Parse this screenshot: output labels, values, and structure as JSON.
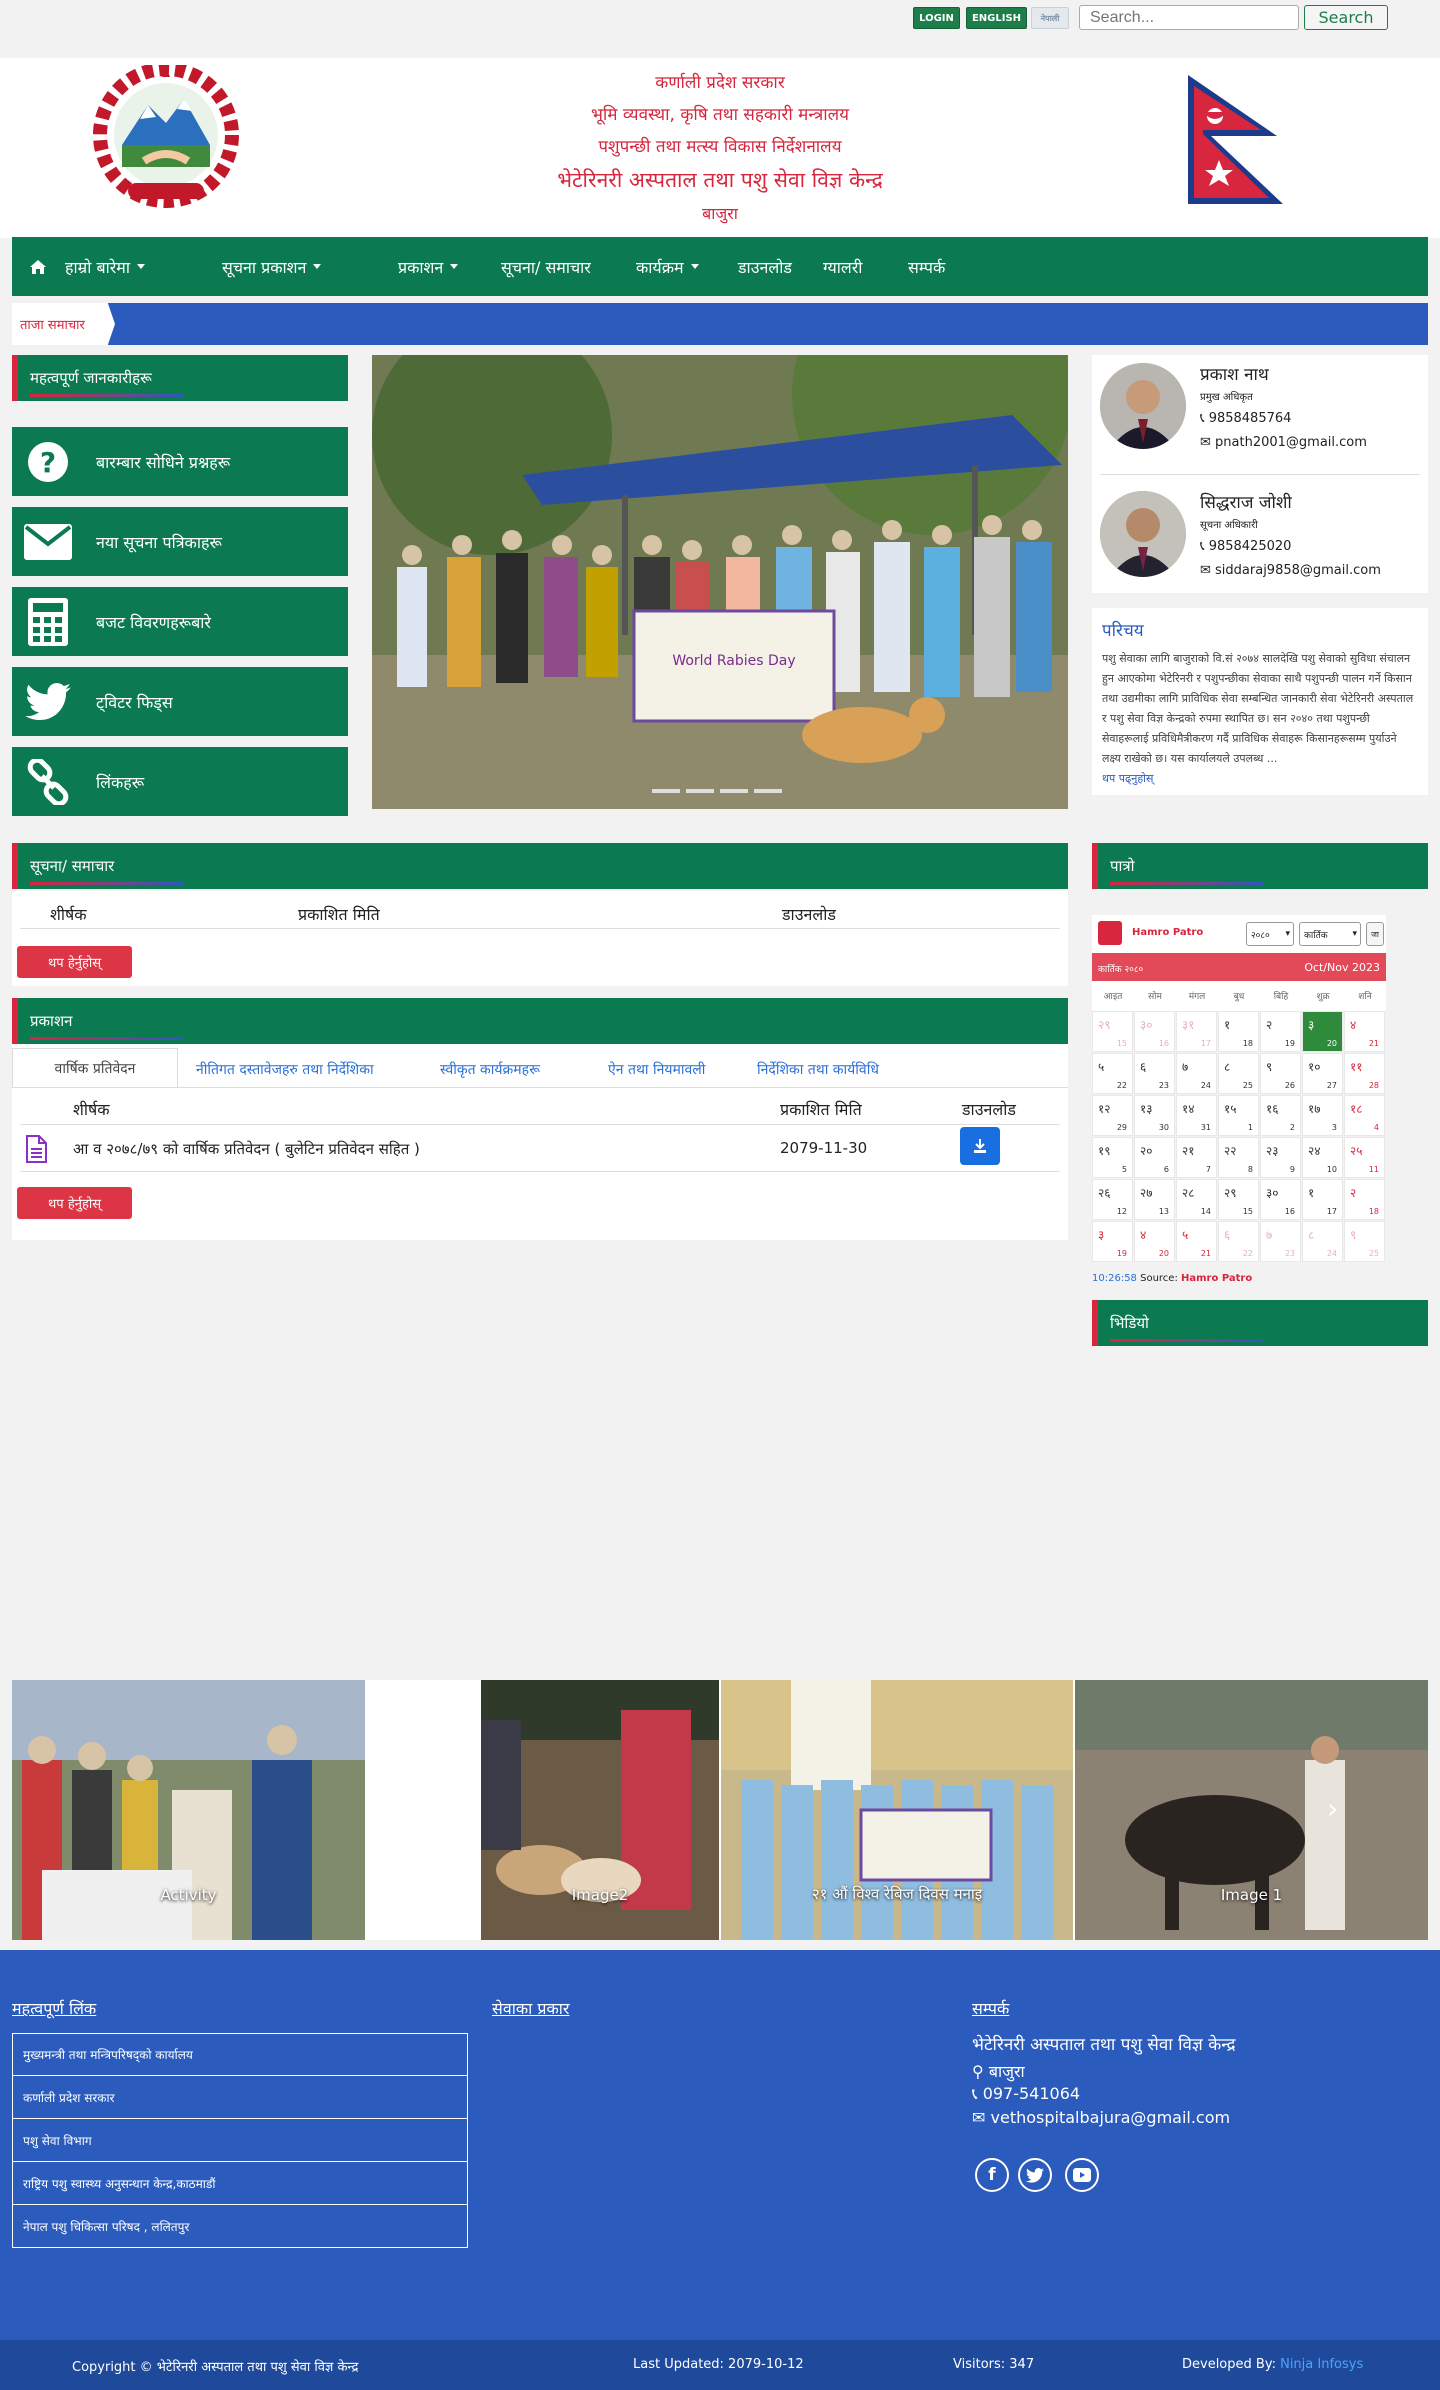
{
  "topbar": {
    "login_label": "LOGIN",
    "english_label": "ENGLISH",
    "nepali_label": "नेपाली",
    "search_placeholder": "Search...",
    "search_button": "Search"
  },
  "header": {
    "line1": "कर्णाली प्रदेश सरकार",
    "line2": "भूमि व्यवस्था, कृषि तथा सहकारी मन्त्रालय",
    "line3": "पशुपन्छी तथा मत्स्य विकास निर्देशनालय",
    "line4": "भेटेरिनरी अस्पताल तथा पशु सेवा विज्ञ केन्द्र",
    "line5": "बाजुरा"
  },
  "nav": {
    "items": [
      {
        "label": "हाम्रो बारेमा",
        "dropdown": true
      },
      {
        "label": "सूचना प्रकाशन",
        "dropdown": true
      },
      {
        "label": "प्रकाशन",
        "dropdown": true
      },
      {
        "label": "सूचना/ समाचार",
        "dropdown": false
      },
      {
        "label": "कार्यक्रम",
        "dropdown": true
      },
      {
        "label": "डाउनलोड",
        "dropdown": false
      },
      {
        "label": "ग्यालरी",
        "dropdown": false
      },
      {
        "label": "सम्पर्क",
        "dropdown": false
      }
    ]
  },
  "news": {
    "tag": "ताजा समाचार"
  },
  "sidebar_left": {
    "title": "महत्वपूर्ण जानकारीहरू",
    "links": [
      {
        "label": "बारम्बार सोधिने प्रश्नहरू",
        "icon": "question-icon"
      },
      {
        "label": "नया सूचना पत्रिकाहरू",
        "icon": "envelope-icon"
      },
      {
        "label": "बजट विवरणहरूबारे",
        "icon": "calculator-icon"
      },
      {
        "label": "ट्विटर फिड्स",
        "icon": "twitter-icon"
      },
      {
        "label": "लिंकहरू",
        "icon": "link-icon"
      }
    ]
  },
  "profiles": [
    {
      "name": "प्रकाश नाथ",
      "role": "प्रमुख अधिकृत",
      "phone": "9858485764",
      "email": "pnath2001@gmail.com"
    },
    {
      "name": "सिद्धराज जोशी",
      "role": "सूचना अधिकारी",
      "phone": "9858425020",
      "email": "siddaraj9858@gmail.com"
    }
  ],
  "about": {
    "title": "परिचय",
    "body": "पशु सेवाका लागि बाजुराको वि.सं २०७४ सालदेखि पशु सेवाको सुविधा संचालन हुन आएकोमा भेटेरिनरी र पशुपन्छीका सेवाका साथै पशुपन्छी पालन गर्ने किसान तथा उद्यमीका लागि प्राविधिक सेवा सम्बन्धित जानकारी सेवा भेटेरिनरी अस्पताल र पशु सेवा विज्ञ केन्द्रको रुपमा स्थापित छ। सन २०४० तथा पशुपन्छी सेवाहरूलाई प्रविधिमैत्रीकरण गर्दै प्राविधिक सेवाहरू किसानहरूसम्म पुर्याउने लक्ष्य राखेको छ। यस कार्यालयले उपलब्ध ...",
    "more": "थप पढ्नुहोस्"
  },
  "notices": {
    "title": "सूचना/ समाचार",
    "columns": [
      "शीर्षक",
      "प्रकाशित मिति",
      "डाउनलोड"
    ],
    "more_button": "थप हेर्नुहोस्"
  },
  "documents": {
    "title": "प्रकाशन",
    "tabs": [
      "वार्षिक प्रतिवेदन",
      "नीतिगत दस्तावेजहरु तथा निर्देशिका",
      "स्वीकृत कार्यक्रमहरू",
      "ऐन तथा नियमावली",
      "निर्देशिका तथा कार्यविधि"
    ],
    "columns": [
      "शीर्षक",
      "प्रकाशित मिति",
      "डाउनलोड"
    ],
    "rows": [
      {
        "title": "आ व २०७८/७९ को वार्षिक प्रतिवेदन ( बुलेटिन प्रतिवेदन सहित )",
        "date": "2079-11-30"
      }
    ],
    "more_button": "थप हेर्नुहोस्"
  },
  "calendar": {
    "title": "पात्रो",
    "brand": "Hamro Patro",
    "year_select": "२०८०",
    "month_select": "कार्तिक",
    "go_label": "जा",
    "month_label": "कार्तिक २०८०",
    "eng_label": "Oct/Nov 2023",
    "weekdays": [
      "आइत",
      "सोम",
      "मंगल",
      "बुध",
      "बिहि",
      "शुक्र",
      "शनि"
    ],
    "time": "10:26:58",
    "source_label": "Source:",
    "source_name": "Hamro Patro",
    "np_days": [
      "२९",
      "३०",
      "३१",
      "१",
      "२",
      "३",
      "४",
      "५",
      "६",
      "७",
      "८",
      "९",
      "१०",
      "११",
      "१२",
      "१३",
      "१४",
      "१५",
      "१६",
      "१७",
      "१८",
      "१९",
      "२०",
      "२१",
      "२२",
      "२३",
      "२४",
      "२५",
      "२६",
      "२७",
      "२८",
      "२९",
      "३०",
      "१",
      "२",
      "३",
      "४",
      "५",
      "६",
      "७",
      "८",
      "९"
    ],
    "en_days": [
      "15",
      "16",
      "17",
      "18",
      "19",
      "20",
      "21",
      "22",
      "23",
      "24",
      "25",
      "26",
      "27",
      "28",
      "29",
      "30",
      "31",
      "1",
      "2",
      "3",
      "4",
      "5",
      "6",
      "7",
      "8",
      "9",
      "10",
      "11",
      "12",
      "13",
      "14",
      "15",
      "16",
      "17",
      "18",
      "19",
      "20",
      "21",
      "22",
      "23",
      "24",
      "25"
    ]
  },
  "video": {
    "title": "भिडियो"
  },
  "gallery": {
    "captions": [
      "Activity",
      "Image2",
      "२१ औं विश्व रेबिज दिवस मनाइ",
      "Image 1"
    ]
  },
  "footer": {
    "links_title": "महत्वपूर्ण लिंक",
    "links": [
      "मुख्यमन्त्री तथा मन्त्रिपरिषद्को कार्यालय",
      "कर्णाली प्रदेश सरकार",
      "पशु सेवा विभाग",
      "राष्ट्रिय पशु स्वास्थ्य अनुसन्धान केन्द्र,काठमाडौं",
      "नेपाल पशु चिकित्सा परिषद , ललितपुर"
    ],
    "services_title": "सेवाका प्रकार",
    "contact_title": "सम्पर्क",
    "contact_office": "भेटेरिनरी अस्पताल तथा पशु सेवा विज्ञ केन्द्र",
    "contact_place": "बाजुरा",
    "contact_phone": "097-541064",
    "contact_email": "vethospitalbajura@gmail.com"
  },
  "bottom": {
    "copyright_prefix": "Copyright ©",
    "copyright_org": "भेटेरिनरी अस्पताल तथा पशु सेवा विज्ञ केन्द्र",
    "last_updated": "Last Updated: 2079-10-12",
    "visitors": "Visitors: 347",
    "developed_by": "Developed By:",
    "developer": "Ninja Infosys"
  },
  "colors": {
    "green": "#0b7a50",
    "blue": "#2a5bbd",
    "red": "#d7263d"
  }
}
